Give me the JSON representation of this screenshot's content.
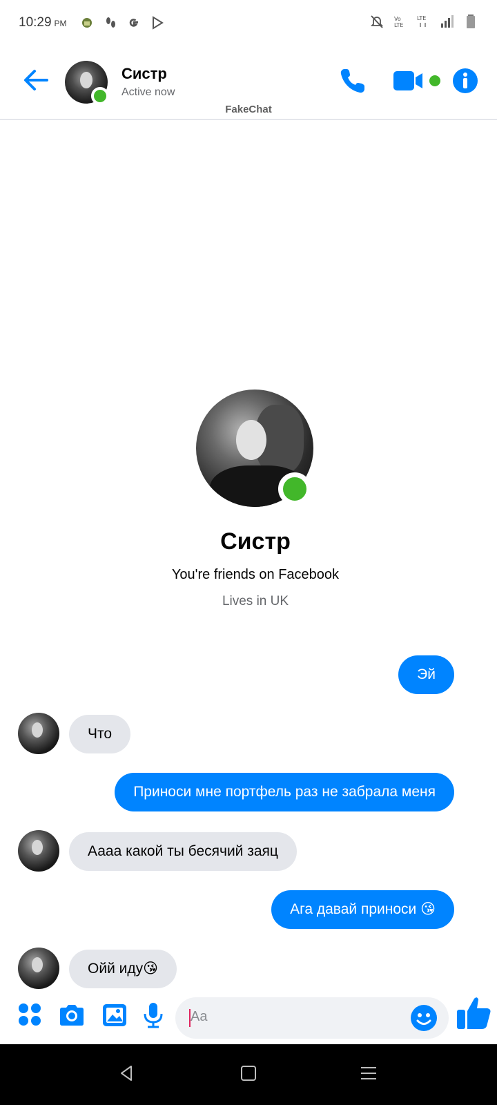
{
  "status_bar": {
    "time": "10:29",
    "ampm": "PM",
    "left_icons": [
      "android-icon",
      "footsteps-icon",
      "google-icon",
      "play-store-icon"
    ],
    "right_icons": [
      "mute-icon",
      "volte-icon",
      "lte-icon",
      "signal-icon",
      "battery-icon"
    ]
  },
  "header": {
    "contact_name": "Систр",
    "status": "Active now",
    "app_label": "FakeChat",
    "accent_color": "#0084ff",
    "online_color": "#42b72a"
  },
  "profile": {
    "name": "Систр",
    "friends_text": "You're friends on Facebook",
    "lives_text": "Lives in UK"
  },
  "messages": [
    {
      "direction": "out",
      "text": "Эй"
    },
    {
      "direction": "in",
      "text": "Что"
    },
    {
      "direction": "out",
      "text": "Приноси мне портфель раз не забрала меня"
    },
    {
      "direction": "in",
      "text": "Аааа какой ты бесячий заяц"
    },
    {
      "direction": "out",
      "text": "Ага давай приноси 😘"
    },
    {
      "direction": "in",
      "text": "Ойй иду😘"
    }
  ],
  "composer": {
    "placeholder": "Aa"
  }
}
